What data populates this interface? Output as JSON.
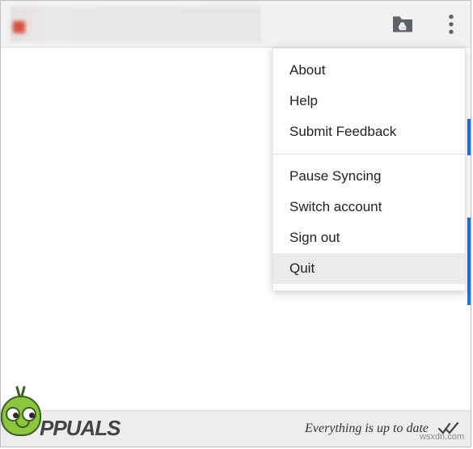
{
  "menu": {
    "section1": {
      "about": "About",
      "help": "Help",
      "feedback": "Submit Feedback"
    },
    "section2": {
      "pause": "Pause Syncing",
      "switch": "Switch account",
      "signout": "Sign out",
      "quit": "Quit"
    }
  },
  "footer": {
    "status": "Everything is up to date"
  },
  "branding": {
    "logo_text": "PPUALS",
    "url": "wsxdn.com"
  }
}
